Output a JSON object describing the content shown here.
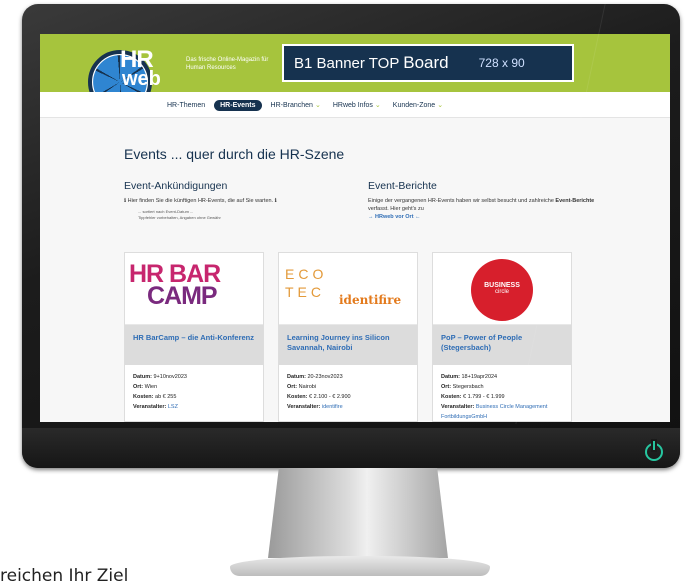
{
  "header": {
    "logo_hr": "HR",
    "logo_web": "web",
    "tagline": "Das frische Online-Magazin für Human Resources",
    "banner_label": "B1 Banner TOP",
    "banner_board": "Board",
    "banner_size": "728 x 90"
  },
  "nav": {
    "items": [
      {
        "label": "HR-Themen",
        "active": false,
        "has_dropdown": false
      },
      {
        "label": "HR-Events",
        "active": true,
        "has_dropdown": false
      },
      {
        "label": "HR-Branchen",
        "active": false,
        "has_dropdown": true
      },
      {
        "label": "HRweb Infos",
        "active": false,
        "has_dropdown": true
      },
      {
        "label": "Kunden-Zone",
        "active": false,
        "has_dropdown": true
      }
    ]
  },
  "page": {
    "title": "Events ... quer durch die HR-Szene"
  },
  "announcements": {
    "title": "Event-Ankündigungen",
    "text": "Hier finden Sie die künftigen HR-Events, die auf Sie warten.",
    "note1": "... sortiert nach Event-Datum ...",
    "note2": "Tippfehler vorbehalten, Angaben ohne Gewähr"
  },
  "reports": {
    "title": "Event-Berichte",
    "text_a": "Einige der vergangenen HR-Events haben wir selbst besucht und zahlreiche",
    "text_bold": "Event-Berichte",
    "text_b": "verfasst. Hier geht's zu",
    "link": "→ HRweb vor Ort ←"
  },
  "cards": [
    {
      "img_line1": "HR BAR",
      "img_line2": "CAMP",
      "title": "HR BarCamp – die Anti-Konferenz",
      "date_label": "Datum:",
      "date": "9+10nov2023",
      "place_label": "Ort:",
      "place": "Wien",
      "cost_label": "Kosten:",
      "cost": "ab € 255",
      "org_label": "Veranstalter:",
      "org": "LSZ"
    },
    {
      "img_line1": "ECO",
      "img_line2": "TEC",
      "img_brand": "identifire",
      "title": "Learning Journey ins Silicon Savannah, Nairobi",
      "date_label": "Datum:",
      "date": "20-23nov2023",
      "place_label": "Ort:",
      "place": "Nairobi",
      "cost_label": "Kosten:",
      "cost": "€ 2.100 - € 2.900",
      "org_label": "Veranstalter:",
      "org": "identifire"
    },
    {
      "img_line1": "BUSINESS",
      "img_line2": "circle",
      "title": "PoP – Power of People (Stegersbach)",
      "date_label": "Datum:",
      "date": "18+19apr2024",
      "place_label": "Ort:",
      "place": "Stegersbach",
      "cost_label": "Kosten:",
      "cost": "€ 1.799 - € 1.999",
      "org_label": "Veranstalter:",
      "org": "Business Circle Management FortbildungsGmbH"
    }
  ],
  "background_text": "reichen Ihr Ziel",
  "colors": {
    "header_green": "#a6c43d",
    "navy": "#16324f",
    "link_blue": "#2f6db5",
    "power_icon": "#27c6a0"
  }
}
